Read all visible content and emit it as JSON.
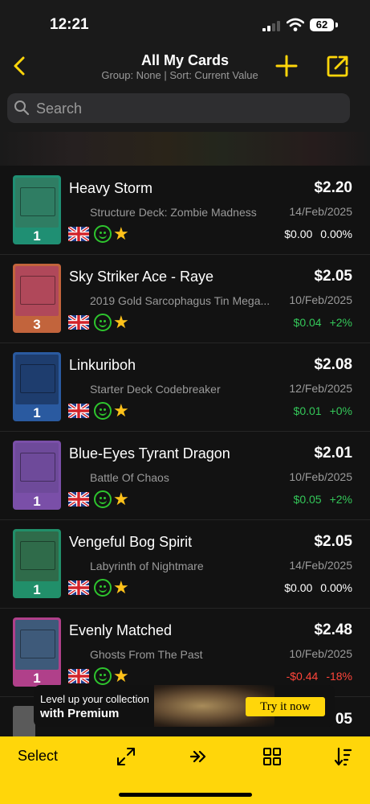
{
  "status_bar": {
    "time": "12:21",
    "battery": "62"
  },
  "nav": {
    "title": "All My Cards",
    "subtitle": "Group: None | Sort: Current Value"
  },
  "search": {
    "placeholder": "Search"
  },
  "cards": [
    {
      "name": "Heavy Storm",
      "set": "Structure Deck: Zombie Madness",
      "qty": "1",
      "price": "$2.20",
      "date": "14/Feb/2025",
      "change_amount": "$0.00",
      "change_percent": "0.00%",
      "trend": "neutral",
      "art_color": "#2f7d63",
      "frame_color": "#1f8f73"
    },
    {
      "name": "Sky Striker Ace - Raye",
      "set": "2019 Gold Sarcophagus Tin Mega...",
      "qty": "3",
      "price": "$2.05",
      "date": "10/Feb/2025",
      "change_amount": "$0.04",
      "change_percent": "+2%",
      "trend": "up",
      "art_color": "#b0485a",
      "frame_color": "#c2643c"
    },
    {
      "name": "Linkuriboh",
      "set": "Starter Deck Codebreaker",
      "qty": "1",
      "price": "$2.08",
      "date": "12/Feb/2025",
      "change_amount": "$0.01",
      "change_percent": "+0%",
      "trend": "up",
      "art_color": "#1e3d6e",
      "frame_color": "#2a5aa0"
    },
    {
      "name": "Blue-Eyes Tyrant Dragon",
      "set": "Battle Of Chaos",
      "qty": "1",
      "price": "$2.01",
      "date": "10/Feb/2025",
      "change_amount": "$0.05",
      "change_percent": "+2%",
      "trend": "up",
      "art_color": "#6e4a9a",
      "frame_color": "#7a4fa8"
    },
    {
      "name": "Vengeful Bog Spirit",
      "set": "Labyrinth of Nightmare",
      "qty": "1",
      "price": "$2.05",
      "date": "14/Feb/2025",
      "change_amount": "$0.00",
      "change_percent": "0.00%",
      "trend": "neutral",
      "art_color": "#2f6b4a",
      "frame_color": "#218f6a"
    },
    {
      "name": "Evenly Matched",
      "set": "Ghosts From The Past",
      "qty": "1",
      "price": "$2.48",
      "date": "10/Feb/2025",
      "change_amount": "-$0.44",
      "change_percent": "-18%",
      "trend": "down",
      "art_color": "#3e5a7a",
      "frame_color": "#b0408a"
    }
  ],
  "partial_row": {
    "price": "05"
  },
  "promo": {
    "line1": "Level up your collection",
    "line2": "with Premium",
    "button": "Try it now"
  },
  "toolbar": {
    "select_label": "Select"
  },
  "colors": {
    "accent": "#ffd60a",
    "positive": "#34c759",
    "negative": "#ff453a",
    "background": "#121212"
  },
  "icons": [
    "back-chevron-icon",
    "plus-icon",
    "share-icon",
    "search-icon",
    "uk-flag-icon",
    "condition-smile-icon",
    "star-icon",
    "expand-icon",
    "forward-icon",
    "grid-icon",
    "sort-icon"
  ]
}
